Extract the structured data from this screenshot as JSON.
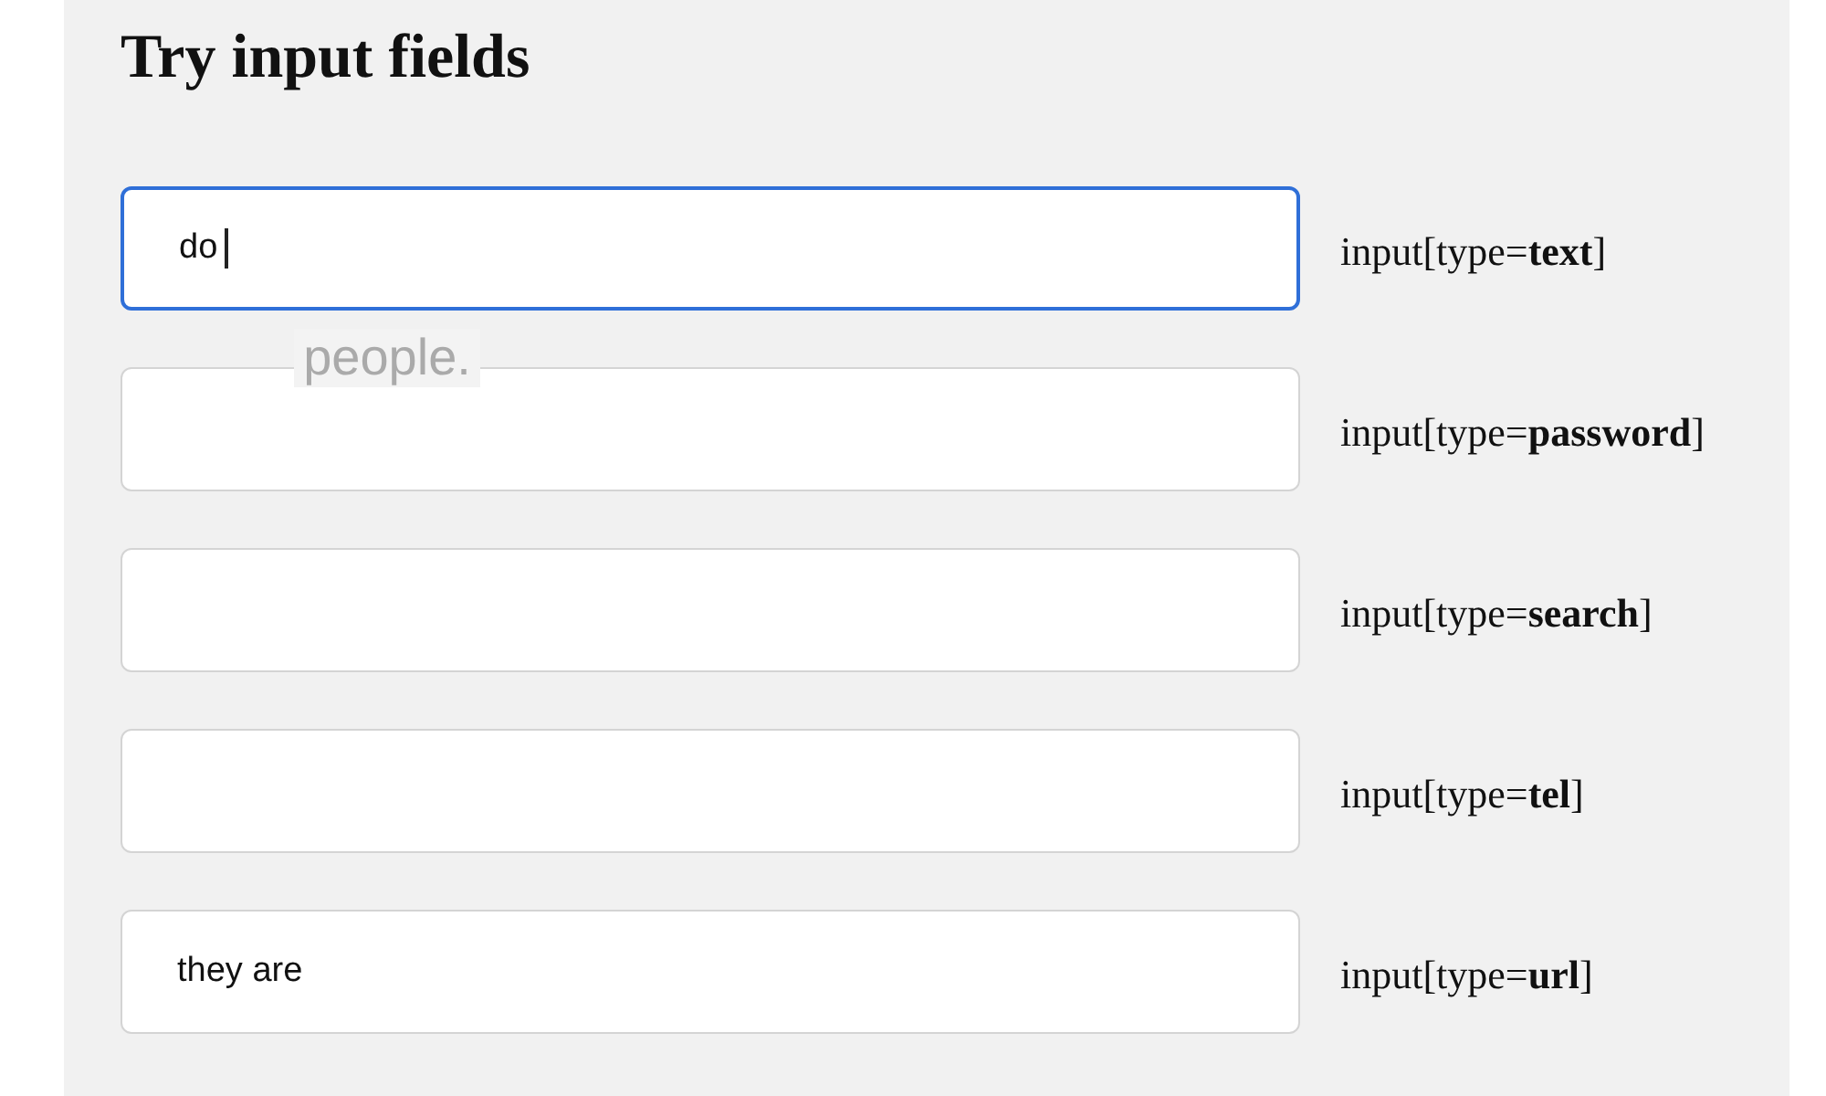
{
  "title": "Try input fields",
  "fields": [
    {
      "value": "do",
      "focused": true,
      "label": "input[type=**text**]"
    },
    {
      "focused": false,
      "label": "input[type=**password**]"
    },
    {
      "focused": false,
      "label": "input[type=**search**]"
    },
    {
      "focused": false,
      "label": "input[type=**tel**]"
    },
    {
      "value": "they are",
      "focused": false,
      "label": "input[type=**url**]"
    }
  ],
  "suggestion": {
    "text": "people."
  }
}
